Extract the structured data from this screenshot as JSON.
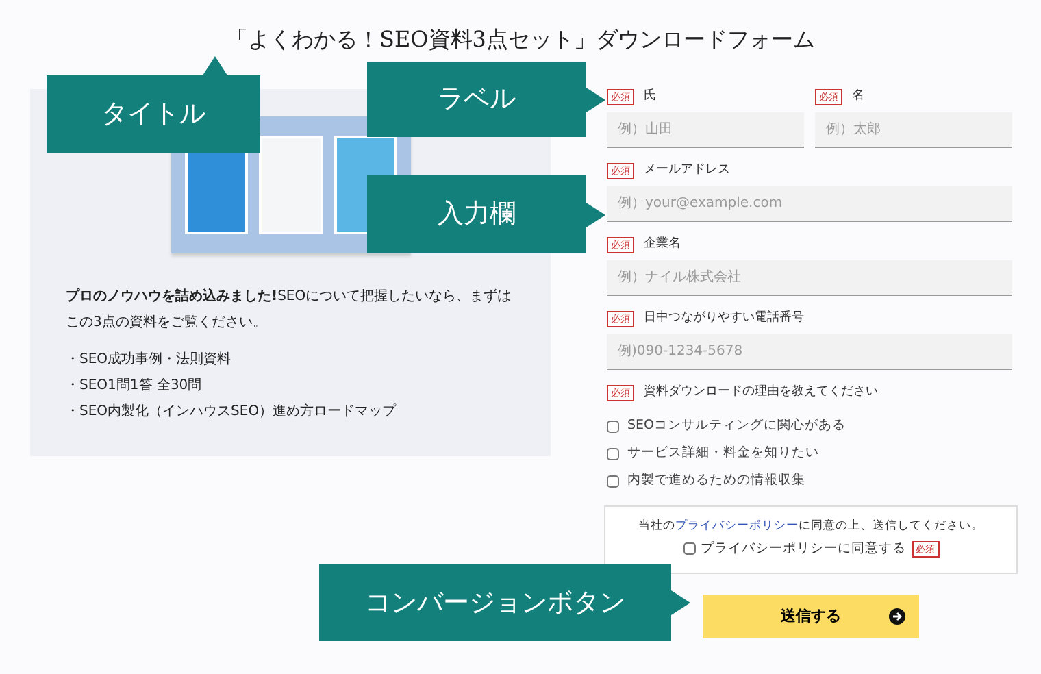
{
  "title": "「よくわかる！SEO資料3点セット」ダウンロードフォーム",
  "intro": {
    "lead": "**プロのノウハウを詰め込みました!**SEOについて把握したいなら、まずはこの3点の資料をご覧ください。",
    "items": [
      "・SEO成功事例・法則資料",
      "・SEO1問1答 全30問",
      "・SEO内製化（インハウスSEO）進め方ロードマップ"
    ]
  },
  "form": {
    "name_fields": [
      {
        "badge": "必須",
        "label": "氏",
        "placeholder": "例）山田"
      },
      {
        "badge": "必須",
        "label": "名",
        "placeholder": "例）太郎"
      }
    ],
    "fields": [
      {
        "badge": "必須",
        "label": "メールアドレス",
        "placeholder": "例）your@example.com"
      },
      {
        "badge": "必須",
        "label": "企業名",
        "placeholder": "例）ナイル株式会社"
      },
      {
        "badge": "必須",
        "label": "日中つながりやすい電話番号",
        "placeholder": "例)090-1234-5678"
      }
    ],
    "reason": {
      "badge": "必須",
      "label": "資料ダウンロードの理由を教えてください",
      "options": [
        {
          "label": "SEOコンサルティングに関心がある",
          "checked": false
        },
        {
          "label": "サービス詳細・料金を知りたい",
          "checked": false
        },
        {
          "label": "内製で進めるための情報収集",
          "checked": false
        }
      ]
    },
    "privacy": {
      "text_before": "当社の",
      "link": "プライバシーポリシー",
      "text_after": "に同意の上、送信してください。",
      "agree": {
        "label": "プライバシーポリシーに同意する",
        "checked": false
      },
      "badge": "必須"
    },
    "submit": {
      "label": "送信する"
    }
  },
  "callouts": [
    {
      "label": "タイトル",
      "kind": "up"
    },
    {
      "label": "ラベル",
      "kind": "right"
    },
    {
      "label": "入力欄",
      "kind": "right"
    },
    {
      "label": "コンバージョンボタン",
      "kind": "right"
    }
  ]
}
